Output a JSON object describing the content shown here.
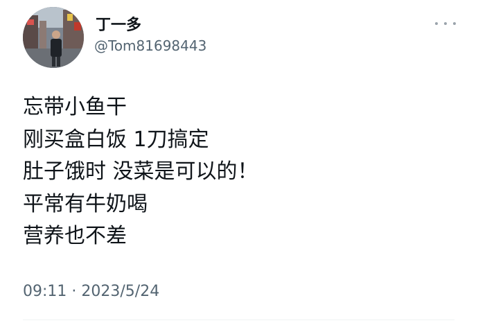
{
  "author": {
    "display_name": "丁一多",
    "handle": "@Tom81698443",
    "avatar_icon": "avatar-photo-icon"
  },
  "menu": {
    "icon": "more-horizontal-icon"
  },
  "tweet": {
    "lines": [
      "忘带小鱼干",
      "刚买盒白饭 1刀搞定",
      "肚子饿时 没菜是可以的！",
      "平常有牛奶喝",
      "营养也不差"
    ],
    "time": "09:11",
    "separator": "·",
    "date": "2023/5/24"
  },
  "colors": {
    "text_primary": "#0f1419",
    "text_secondary": "#536471",
    "divider": "#eff3f4",
    "menu_dots": "#9aa3ab"
  }
}
